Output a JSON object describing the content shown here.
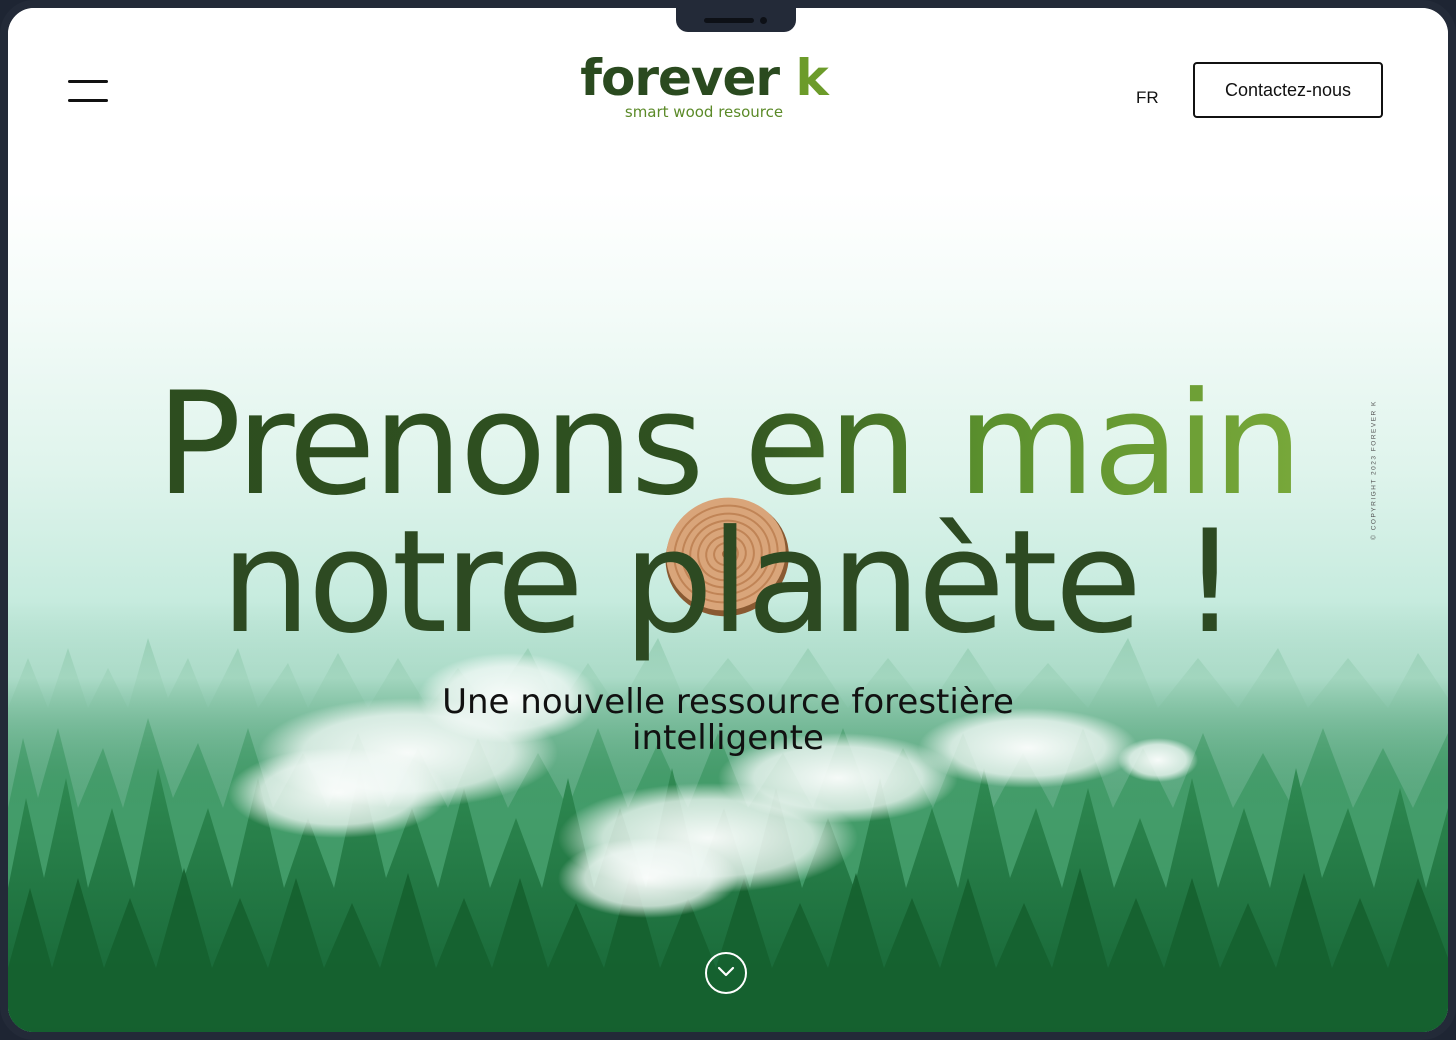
{
  "header": {
    "menu_icon": "hamburger-menu-icon",
    "logo": {
      "word_main": "forever",
      "word_accent": "k",
      "tagline": "smart wood resource"
    },
    "language": "FR",
    "contact_label": "Contactez-nous"
  },
  "hero": {
    "title_line1": "Prenons en main",
    "title_line2": "notre planète !",
    "subtitle": "Une nouvelle ressource forestière intelligente",
    "scroll_icon": "chevron-down-circle-icon"
  },
  "side": {
    "copyright": "© COPYRIGHT 2023 FOREVER K"
  },
  "colors": {
    "brand_dark_green": "#2a4a1f",
    "brand_light_green": "#6c9b2a",
    "forest_green": "#1f7a45",
    "device_frame": "#232a38"
  }
}
